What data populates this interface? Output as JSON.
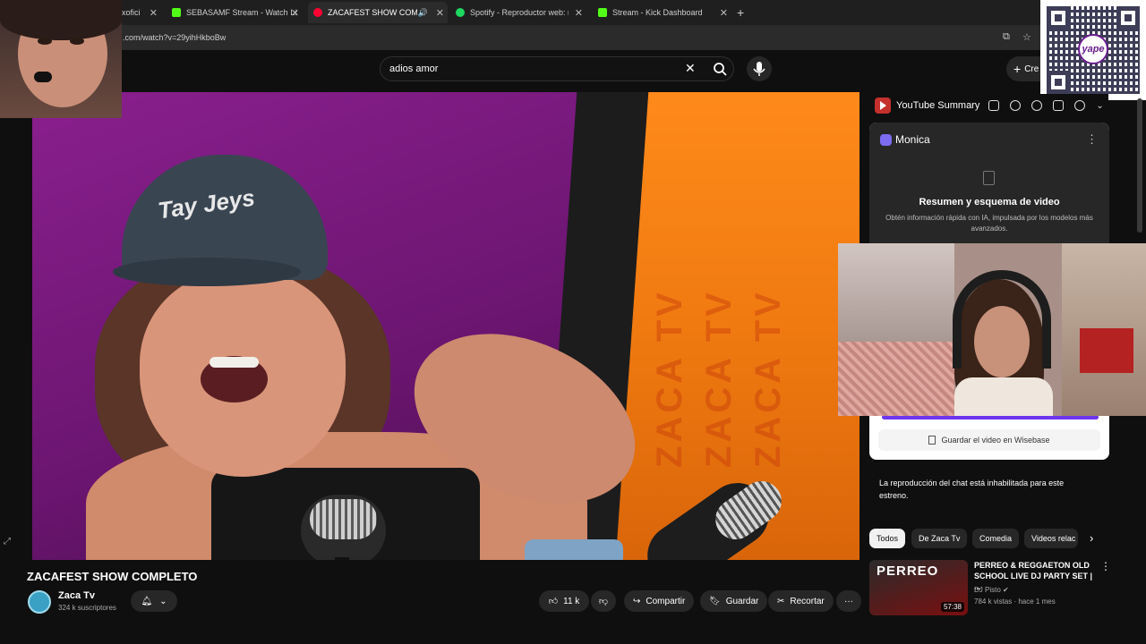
{
  "browser": {
    "tabs": [
      {
        "title": "oxofici",
        "favicon": "#9c27b0"
      },
      {
        "title": "SEBASAMF Stream - Watch Live",
        "favicon": "#53fc18"
      },
      {
        "title": "ZACAFEST SHOW COMPLETO",
        "favicon": "#ff0033",
        "active": true
      },
      {
        "title": "Spotify - Reproductor web: mú",
        "favicon": "#1ed760"
      },
      {
        "title": "Stream - Kick Dashboard",
        "favicon": "#53fc18"
      }
    ],
    "url": ".com/watch?v=29yihHkboBw"
  },
  "header": {
    "search_value": "adios amor",
    "create_label": "Cre"
  },
  "video": {
    "watermark": "ZACA TV",
    "cap_text": "Tay Jeys"
  },
  "extension": {
    "title": "YouTube Summary"
  },
  "monica": {
    "title": "Monica",
    "summary_title": "Resumen y esquema de video",
    "summary_desc": "Obtén información rápida con IA, impulsada por los modelos más avanzados.",
    "wisebase_label": "Guardar el video en Wisebase"
  },
  "qr": {
    "logo_text": "yape"
  },
  "chat_disabled": "La reproducción del chat está inhabilitada para este estreno.",
  "chips": [
    "Todos",
    "De Zaca Tv",
    "Comedia",
    "Videos relac"
  ],
  "recommended": {
    "thumb_text": "PERREO",
    "duration": "57:38",
    "title": "PERREO & REGGAETON OLD SCHOOL LIVE DJ PARTY SET | ...",
    "channel": "DJ Pisto",
    "meta": "784 k vistas · hace 1 mes"
  },
  "video_info": {
    "title": "ZACAFEST SHOW COMPLETO",
    "channel": "Zaca Tv",
    "subscribers": "324 k suscriptores",
    "likes": "11 k",
    "share_label": "Compartir",
    "save_label": "Guardar",
    "clip_label": "Recortar",
    "more_label": "···"
  },
  "colors": {
    "background": "#0f0f0f",
    "accent_red": "#ff0033",
    "monica_purple": "#6c35f0"
  }
}
